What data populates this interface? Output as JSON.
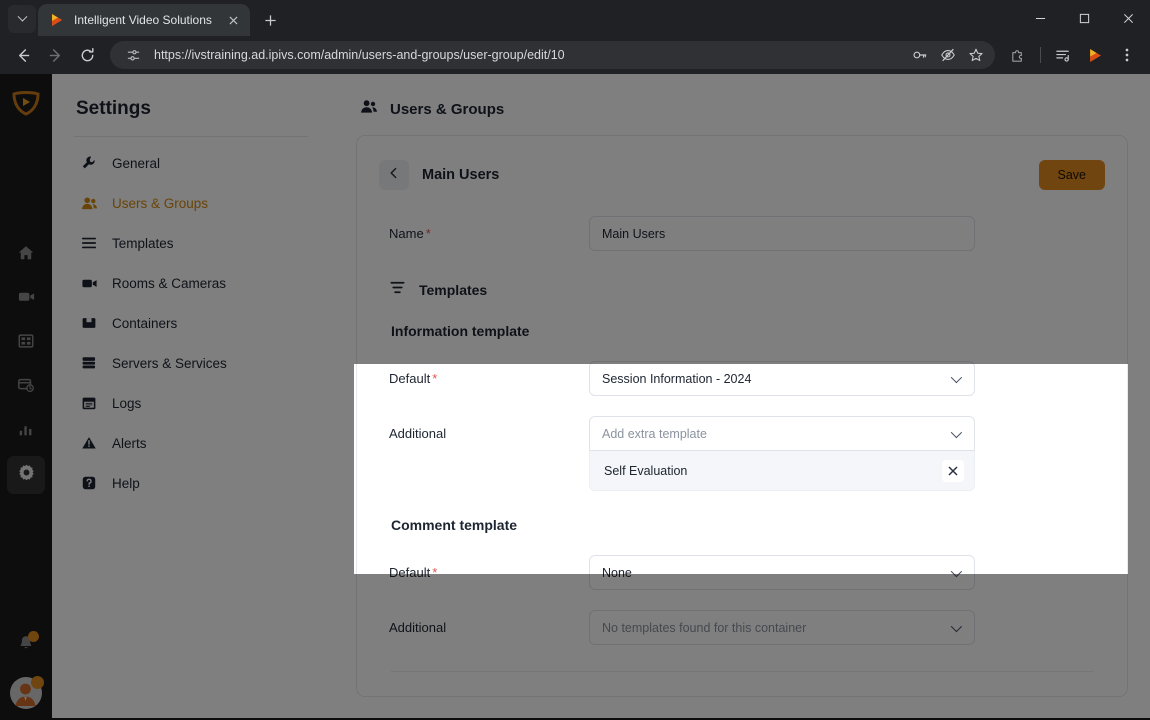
{
  "browser": {
    "tab": {
      "title": "Intelligent Video Solutions",
      "favicon_icon": "ivs-play-logo-icon",
      "close_icon": "close-icon"
    },
    "tab_search_icon": "chevron-down-icon",
    "new_tab_icon": "plus-icon",
    "window_controls": {
      "minimize": "minimize-icon",
      "maximize": "maximize-icon",
      "close": "close-icon"
    },
    "nav": {
      "back_icon": "arrow-left-icon",
      "forward_icon": "arrow-right-icon",
      "reload_icon": "reload-icon"
    },
    "omnibox": {
      "site_info_icon": "page-settings-icon",
      "url": "https://ivstraining.ad.ipivs.com/admin/users-and-groups/user-group/edit/10",
      "actions": [
        "password-key-icon",
        "eye-off-icon",
        "bookmark-star-icon"
      ]
    },
    "toolbar_right": [
      "extensions-puzzle-icon",
      "reading-list-icon",
      "ivs-play-logo-icon",
      "kebab-menu-icon"
    ]
  },
  "rail": {
    "logo_icon": "ivs-shield-logo-icon",
    "items": [
      {
        "name": "home",
        "icon": "home-icon",
        "active": false
      },
      {
        "name": "recordings",
        "icon": "video-camera-icon",
        "active": false
      },
      {
        "name": "media",
        "icon": "film-strip-icon",
        "active": false
      },
      {
        "name": "scheduling",
        "icon": "card-clock-icon",
        "active": false
      },
      {
        "name": "analytics",
        "icon": "bar-chart-icon",
        "active": false
      },
      {
        "name": "settings",
        "icon": "gear-icon",
        "active": true
      }
    ],
    "notifications_icon": "bell-icon",
    "notifications_has_badge": true,
    "avatar_icon": "user-avatar-icon",
    "avatar_has_badge": true
  },
  "settings_nav": {
    "title": "Settings",
    "items": [
      {
        "label": "General",
        "icon": "wrench-icon",
        "active": false
      },
      {
        "label": "Users & Groups",
        "icon": "users-icon",
        "active": true
      },
      {
        "label": "Templates",
        "icon": "list-icon",
        "active": false
      },
      {
        "label": "Rooms & Cameras",
        "icon": "video-camera-icon",
        "active": false
      },
      {
        "label": "Containers",
        "icon": "box-icon",
        "active": false
      },
      {
        "label": "Servers & Services",
        "icon": "server-icon",
        "active": false
      },
      {
        "label": "Logs",
        "icon": "calendar-icon",
        "active": false
      },
      {
        "label": "Alerts",
        "icon": "warning-triangle-icon",
        "active": false
      },
      {
        "label": "Help",
        "icon": "help-badge-icon",
        "active": false
      }
    ]
  },
  "main": {
    "page_title": "Users & Groups",
    "page_title_icon": "users-icon",
    "card": {
      "back_icon": "chevron-left-icon",
      "title": "Main Users",
      "save_label": "Save",
      "name_label": "Name",
      "name_required": "*",
      "name_value": "Main Users",
      "templates_section": {
        "title": "Templates",
        "icon": "sliders-icon"
      },
      "information_template": {
        "title": "Information template",
        "default_label": "Default",
        "default_required": "*",
        "default_value": "Session Information - 2024",
        "additional_label": "Additional",
        "additional_placeholder": "Add extra template",
        "selected_items": [
          {
            "label": "Self Evaluation",
            "remove_icon": "close-icon"
          }
        ]
      },
      "comment_template": {
        "title": "Comment template",
        "default_label": "Default",
        "default_required": "*",
        "default_value": "None",
        "additional_label": "Additional",
        "additional_placeholder": "No templates found for this container"
      }
    }
  },
  "colors": {
    "accent": "#e08b1e",
    "accent_nav": "#d3880f",
    "required": "#e0574f",
    "text": "#1d2531",
    "placeholder": "#8b939f",
    "border": "#dfe3e8",
    "rail_bg": "#1b1b1b",
    "overlay": "rgba(0,0,0,0.5)"
  }
}
